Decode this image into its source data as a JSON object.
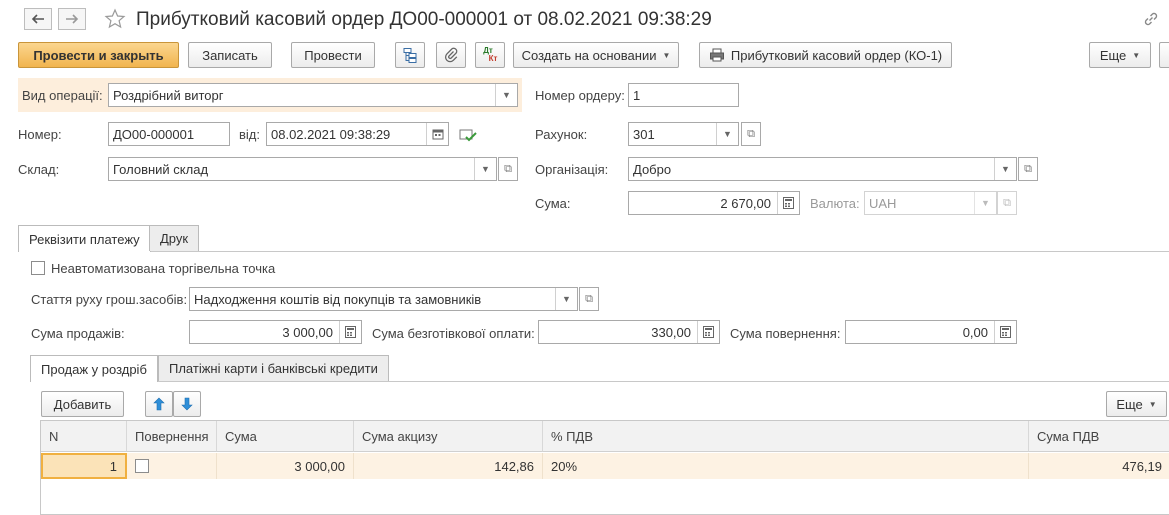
{
  "header": {
    "title": "Прибутковий касовий ордер ДО00-000001 от 08.02.2021 09:38:29"
  },
  "toolbar": {
    "post_close": "Провести и закрыть",
    "save": "Записать",
    "post": "Провести",
    "create_based": "Создать на основании",
    "print_form": "Прибутковий касовий ордер (КО-1)",
    "more": "Еще",
    "dt_kt_top": "Дт",
    "dt_kt_bottom": "Кт"
  },
  "form": {
    "operation_label": "Вид операції:",
    "operation_value": "Роздрібний виторг",
    "order_no_label": "Номер ордеру:",
    "order_no_value": "1",
    "number_label": "Номер:",
    "number_value": "ДО00-000001",
    "date_label": "від:",
    "date_value": "08.02.2021 09:38:29",
    "account_label": "Рахунок:",
    "account_value": "301",
    "warehouse_label": "Склад:",
    "warehouse_value": "Головний склад",
    "organization_label": "Організація:",
    "organization_value": "Добро",
    "amount_label": "Сума:",
    "amount_value": "2 670,00",
    "currency_label": "Валюта:",
    "currency_value": "UAH"
  },
  "tabs": [
    {
      "label": "Реквізити платежу"
    },
    {
      "label": "Друк"
    }
  ],
  "payment": {
    "non_auto_label": "Неавтоматизована торгівельна точка",
    "cash_flow_label": "Стаття руху грош.засобів:",
    "cash_flow_value": "Надходження коштів від покупців та замовників",
    "sales_sum_label": "Сума продажів:",
    "sales_sum_value": "3 000,00",
    "cashless_label": "Сума безготівкової оплати:",
    "cashless_value": "330,00",
    "refunds_label": "Сума повернення:",
    "refunds_value": "0,00"
  },
  "subtabs": [
    {
      "label": "Продаж у роздріб"
    },
    {
      "label": "Платіжні карти і банківські кредити"
    }
  ],
  "table": {
    "add_label": "Добавить",
    "more_label": "Еще",
    "columns": [
      "N",
      "Повернення",
      "Сума",
      "Сума акцизу",
      "% ПДВ",
      "Сума ПДВ"
    ],
    "rows": [
      {
        "n": "1",
        "sum": "3 000,00",
        "excise": "142,86",
        "vat_rate": "20%",
        "vat_sum": "476,19"
      }
    ]
  }
}
